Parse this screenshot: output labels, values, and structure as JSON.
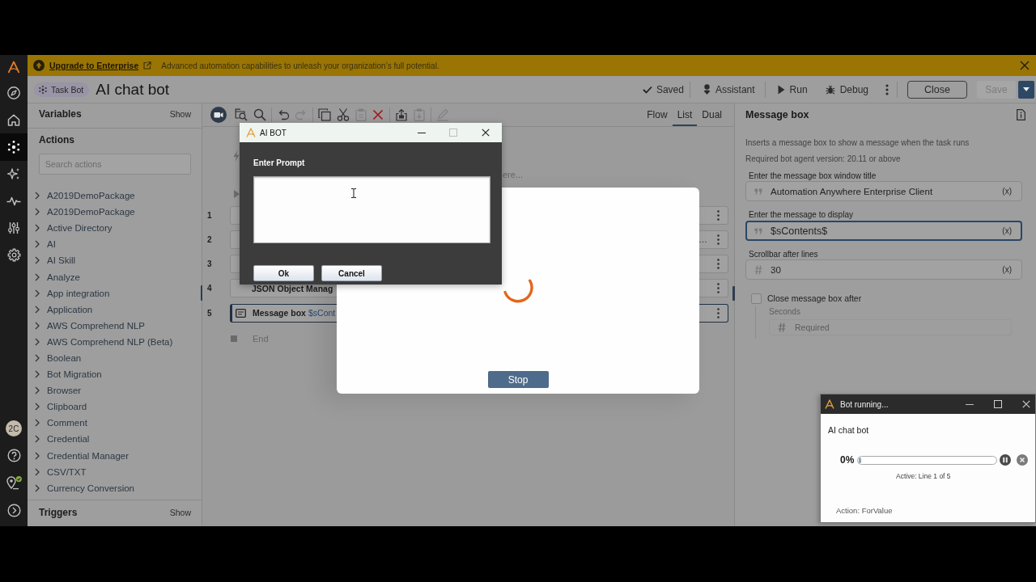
{
  "rail": {
    "items": [
      {
        "selected": false
      },
      {
        "selected": false
      },
      {
        "selected": true
      },
      {
        "selected": false
      },
      {
        "selected": false
      },
      {
        "selected": false
      },
      {
        "selected": false
      }
    ],
    "avatar": "2C"
  },
  "banner": {
    "link": "Upgrade to Enterprise",
    "message": "Advanced automation capabilities to unleash your organization’s full potential."
  },
  "header": {
    "badge": "Task Bot",
    "title": "AI chat bot",
    "status": "Saved",
    "actions": [
      {
        "label": "Assistant"
      },
      {
        "label": "Run"
      },
      {
        "label": "Debug"
      }
    ],
    "close": "Close",
    "save": {
      "label": "Save",
      "disabled": true
    }
  },
  "left_panel": {
    "variables": {
      "title": "Variables",
      "toggle": "Show"
    },
    "actions": {
      "title": "Actions",
      "search": {
        "placeholder": "Search actions"
      },
      "items": [
        {
          "label": "A2019DemoPackage",
          "expanded": false
        },
        {
          "label": "A2019DemoPackage",
          "expanded": false
        },
        {
          "label": "Active Directory",
          "expanded": false
        },
        {
          "label": "AI",
          "expanded": false
        },
        {
          "label": "AI Skill",
          "expanded": false
        },
        {
          "label": "Analyze",
          "expanded": false
        },
        {
          "label": "App integration",
          "expanded": false
        },
        {
          "label": "Application",
          "expanded": false
        },
        {
          "label": "AWS Comprehend NLP",
          "expanded": false
        },
        {
          "label": "AWS Comprehend NLP (Beta)",
          "expanded": false
        },
        {
          "label": "Boolean",
          "expanded": false
        },
        {
          "label": "Bot Migration",
          "expanded": false
        },
        {
          "label": "Browser",
          "expanded": false
        },
        {
          "label": "Clipboard",
          "expanded": false
        },
        {
          "label": "Comment",
          "expanded": false
        },
        {
          "label": "Credential",
          "expanded": false
        },
        {
          "label": "Credential Manager",
          "expanded": false
        },
        {
          "label": "CSV/TXT",
          "expanded": false
        },
        {
          "label": "Currency Conversion",
          "expanded": false
        }
      ]
    },
    "triggers": {
      "title": "Triggers",
      "toggle": "Show"
    }
  },
  "editor": {
    "toolbar": [
      {
        "disabled": false
      },
      {
        "disabled": false
      },
      {
        "disabled": false
      },
      {
        "disabled": false
      },
      {
        "disabled": true
      },
      {
        "disabled": false
      },
      {
        "disabled": false
      },
      {
        "disabled": true
      },
      {
        "disabled": false
      },
      {
        "disabled": false
      },
      {
        "disabled": true
      },
      {
        "disabled": true
      }
    ],
    "views": [
      {
        "label": "Flow",
        "selected": false
      },
      {
        "label": "List",
        "selected": true
      },
      {
        "label": "Dual",
        "selected": false
      }
    ],
    "hint": "ere...",
    "rows": [
      {
        "number": "1",
        "selected": false
      },
      {
        "number": "2",
        "trailing": "…",
        "selected": false
      },
      {
        "number": "3",
        "selected": false
      },
      {
        "number": "4",
        "label": "JSON Object Manag",
        "selected": false
      },
      {
        "number": "5",
        "label": "Message box",
        "detail": "$sCont",
        "selected": true
      }
    ],
    "end": "End"
  },
  "properties": {
    "title": "Message box",
    "description": "Inserts a message box to show a message when the task runs",
    "requirement": "Required bot agent version: 20.11 or above",
    "fields": [
      {
        "label": "Enter the message box window title",
        "kind": "text",
        "value": "Automation Anywhere Enterprise Client",
        "variable": "(x)",
        "focused": false
      },
      {
        "label": "Enter the message to display",
        "kind": "text",
        "value": "$sContents$",
        "variable": "(x)",
        "focused": true
      },
      {
        "label": "Scrollbar after lines",
        "kind": "number",
        "value": "30",
        "variable": "(x)",
        "focused": false
      }
    ],
    "close_after": {
      "label": "Close message box after",
      "checked": false,
      "seconds": {
        "label": "Seconds",
        "placeholder": "Required",
        "disabled": true
      }
    }
  },
  "progress_modal": {
    "button": "Stop"
  },
  "prompt_dialog": {
    "title": "AI BOT",
    "label": "Enter Prompt",
    "buttons": [
      {
        "label": "Ok"
      },
      {
        "label": "Cancel"
      }
    ]
  },
  "bot_runner": {
    "title": "Bot running...",
    "bot_name": "AI chat bot",
    "percent": "0%",
    "level": 0,
    "status": "Active: Line 1 of 5",
    "action": "Action: ForValue"
  }
}
